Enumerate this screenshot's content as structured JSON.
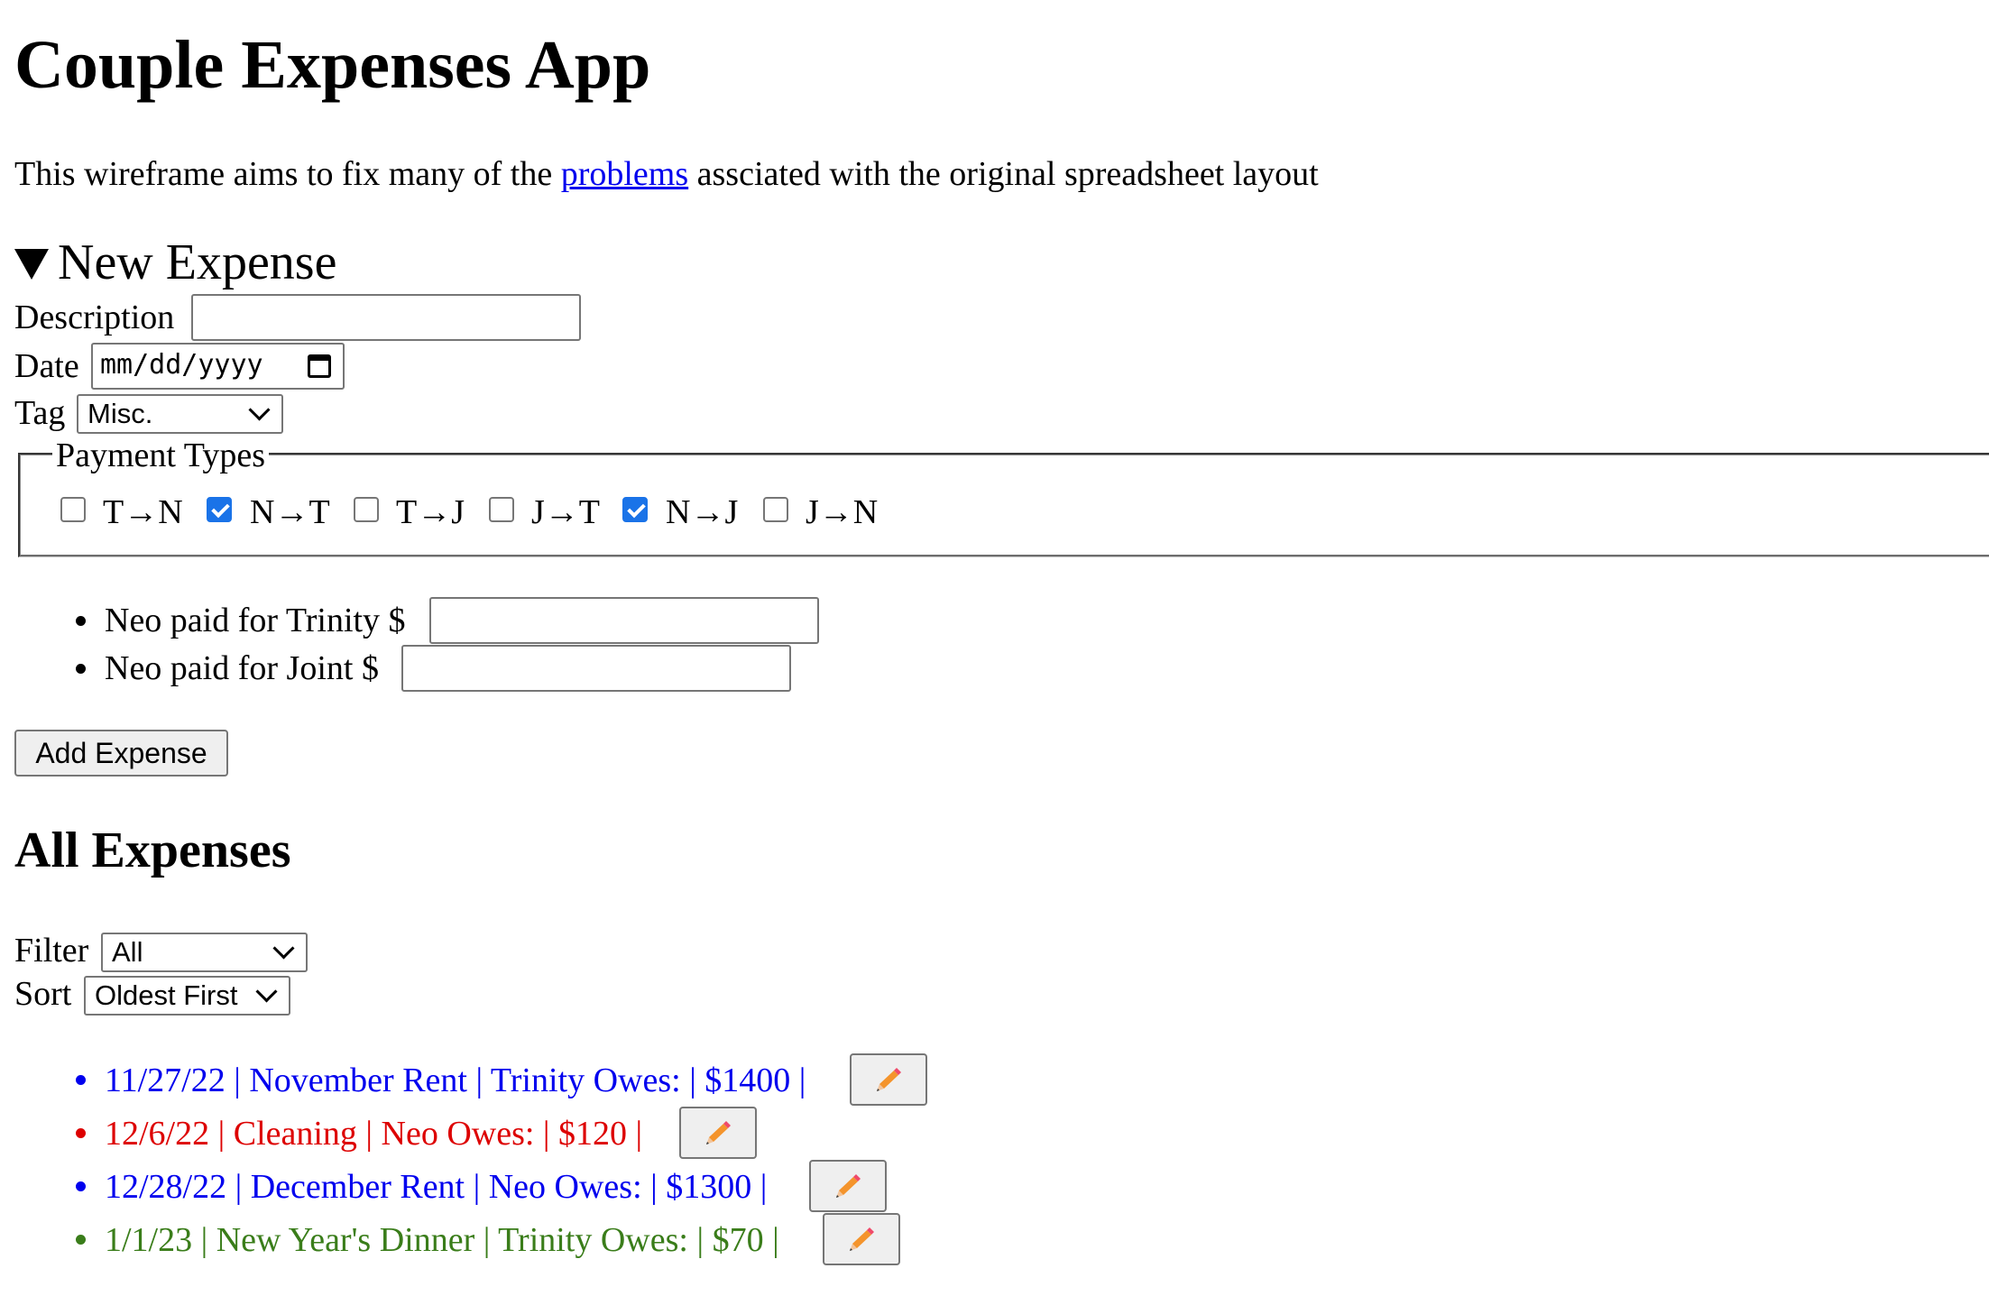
{
  "app": {
    "title": "Couple Expenses App",
    "intro_before": "This wireframe aims to fix many of the ",
    "intro_link": "problems",
    "intro_after": " assciated with the original spreadsheet layout"
  },
  "new_expense": {
    "summary": "New Expense",
    "description_label": "Description",
    "description_value": "",
    "date_label": "Date",
    "date_placeholder": "mm/dd/yyyy",
    "tag_label": "Tag",
    "tag_value": "Misc.",
    "payment_types": {
      "legend": "Payment Types",
      "options": [
        {
          "label": "T→N",
          "checked": false
        },
        {
          "label": "N→T",
          "checked": true
        },
        {
          "label": "T→J",
          "checked": false
        },
        {
          "label": "J→T",
          "checked": false
        },
        {
          "label": "N→J",
          "checked": true
        },
        {
          "label": "J→N",
          "checked": false
        }
      ]
    },
    "amounts": [
      {
        "label": "Neo paid for Trinity $",
        "value": ""
      },
      {
        "label": "Neo paid for Joint $",
        "value": ""
      }
    ],
    "add_button": "Add Expense"
  },
  "all_expenses": {
    "heading": "All Expenses",
    "filter_label": "Filter",
    "filter_value": "All",
    "sort_label": "Sort",
    "sort_value": "Oldest First",
    "items": [
      {
        "text": "11/27/22 | November Rent | Trinity Owes: | $1400 |",
        "color": "#0000ee"
      },
      {
        "text": "12/6/22 | Cleaning | Neo Owes: | $120 |",
        "color": "#dd0000"
      },
      {
        "text": "12/28/22 | December Rent | Neo Owes: | $1300 |",
        "color": "#0000ee"
      },
      {
        "text": "1/1/23 | New Year's Dinner | Trinity Owes: | $70 |",
        "color": "#3a7d1a"
      }
    ],
    "edit_icon": "pencil-icon"
  }
}
